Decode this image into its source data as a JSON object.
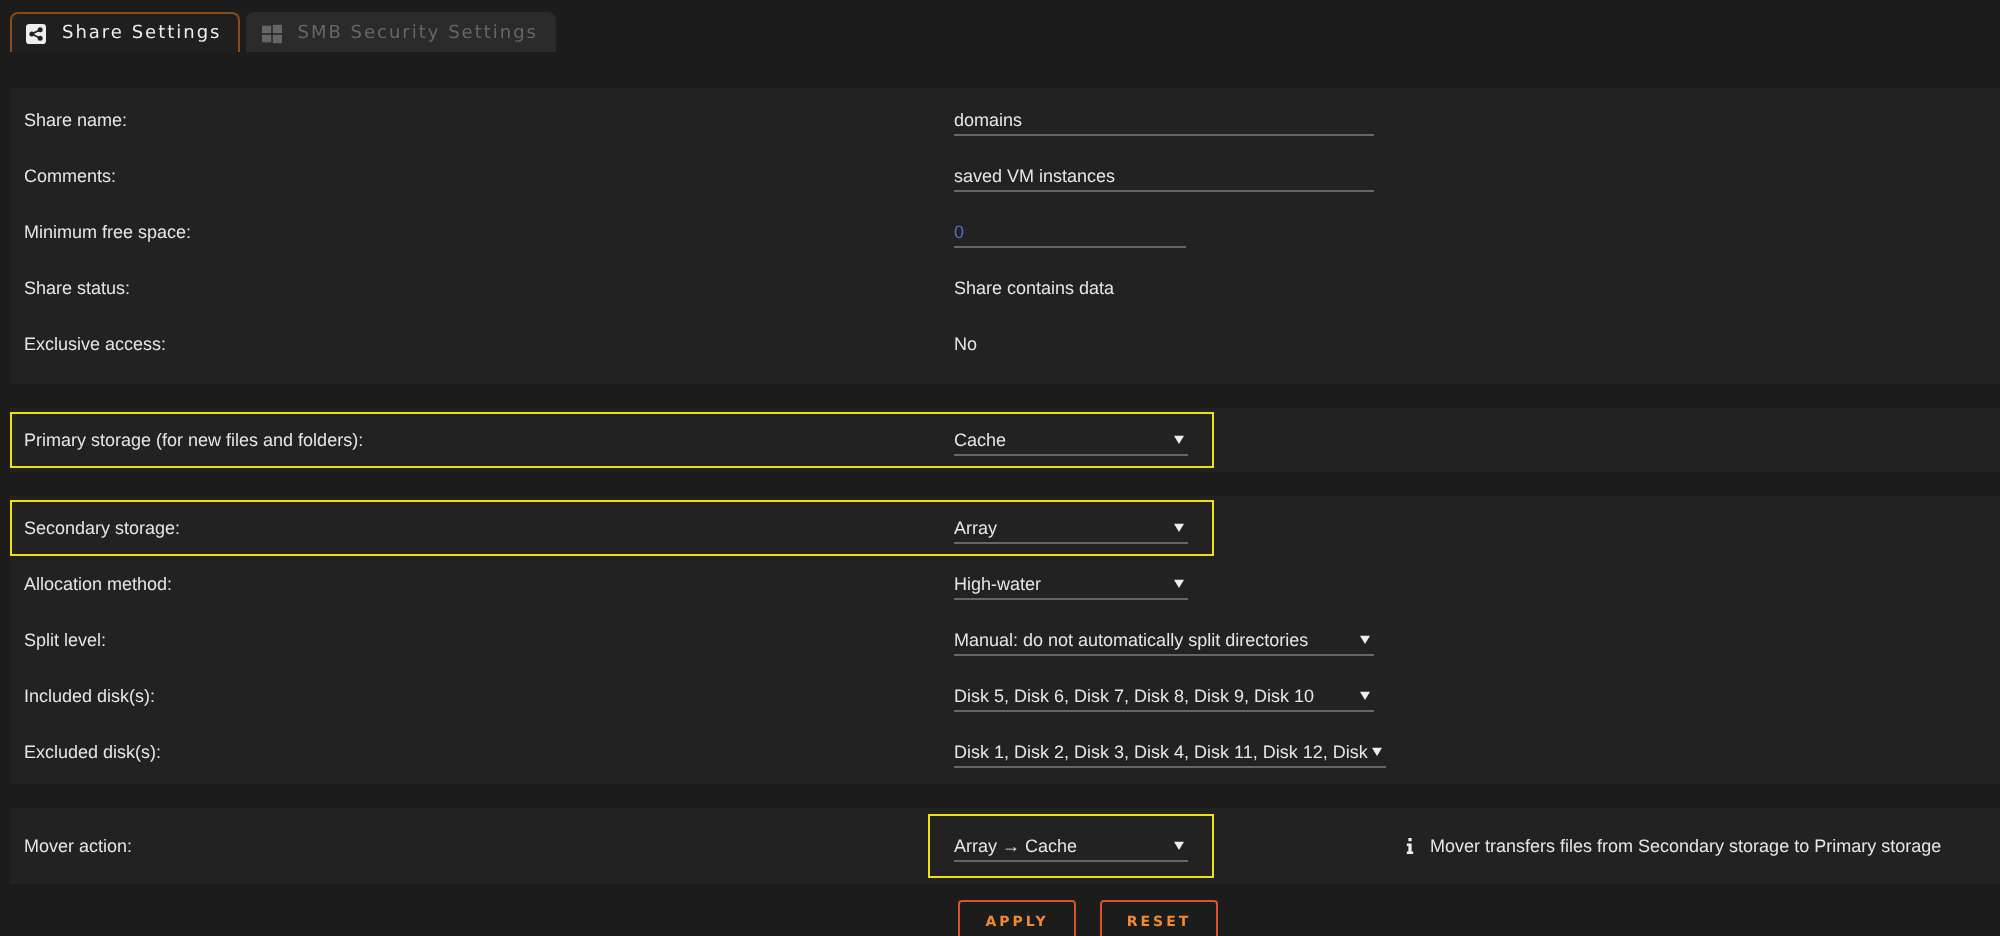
{
  "tabs": [
    {
      "label": "Share Settings",
      "selected": true
    },
    {
      "label": "SMB Security Settings",
      "selected": false
    }
  ],
  "sections": [
    {
      "rows": [
        {
          "label": "Share name:",
          "kind": "input",
          "value": "domains",
          "highlighted": false
        },
        {
          "label": "Comments:",
          "kind": "input",
          "value": "saved VM instances",
          "highlighted": false
        },
        {
          "label": "Minimum free space:",
          "kind": "input",
          "value": "0",
          "highlighted": false
        },
        {
          "label": "Share status:",
          "kind": "text",
          "value": "Share contains data",
          "highlighted": false
        },
        {
          "label": "Exclusive access:",
          "kind": "text",
          "value": "No",
          "highlighted": false
        }
      ]
    },
    {
      "rows": [
        {
          "label": "Primary storage (for new files and folders):",
          "kind": "select",
          "value": "Cache",
          "highlighted": true
        }
      ]
    },
    {
      "rows": [
        {
          "label": "Secondary storage:",
          "kind": "select",
          "value": "Array",
          "highlighted": true
        },
        {
          "label": "Allocation method:",
          "kind": "select",
          "value": "High-water",
          "highlighted": false
        },
        {
          "label": "Split level:",
          "kind": "select",
          "value": "Manual: do not automatically split directories",
          "highlighted": false
        },
        {
          "label": "Included disk(s):",
          "kind": "select",
          "value": "Disk 5, Disk 6, Disk 7, Disk 8, Disk 9, Disk 10",
          "highlighted": false
        },
        {
          "label": "Excluded disk(s):",
          "kind": "select",
          "value": "Disk 1, Disk 2, Disk 3, Disk 4, Disk 11, Disk 12, Disk",
          "highlighted": false
        }
      ]
    },
    {
      "rows": [
        {
          "label": "Mover action:",
          "kind": "select",
          "value": "Array → Cache",
          "highlighted": true,
          "note": "Mover transfers files from Secondary storage to Primary storage"
        }
      ]
    }
  ],
  "buttons": [
    "APPLY",
    "RESET"
  ]
}
